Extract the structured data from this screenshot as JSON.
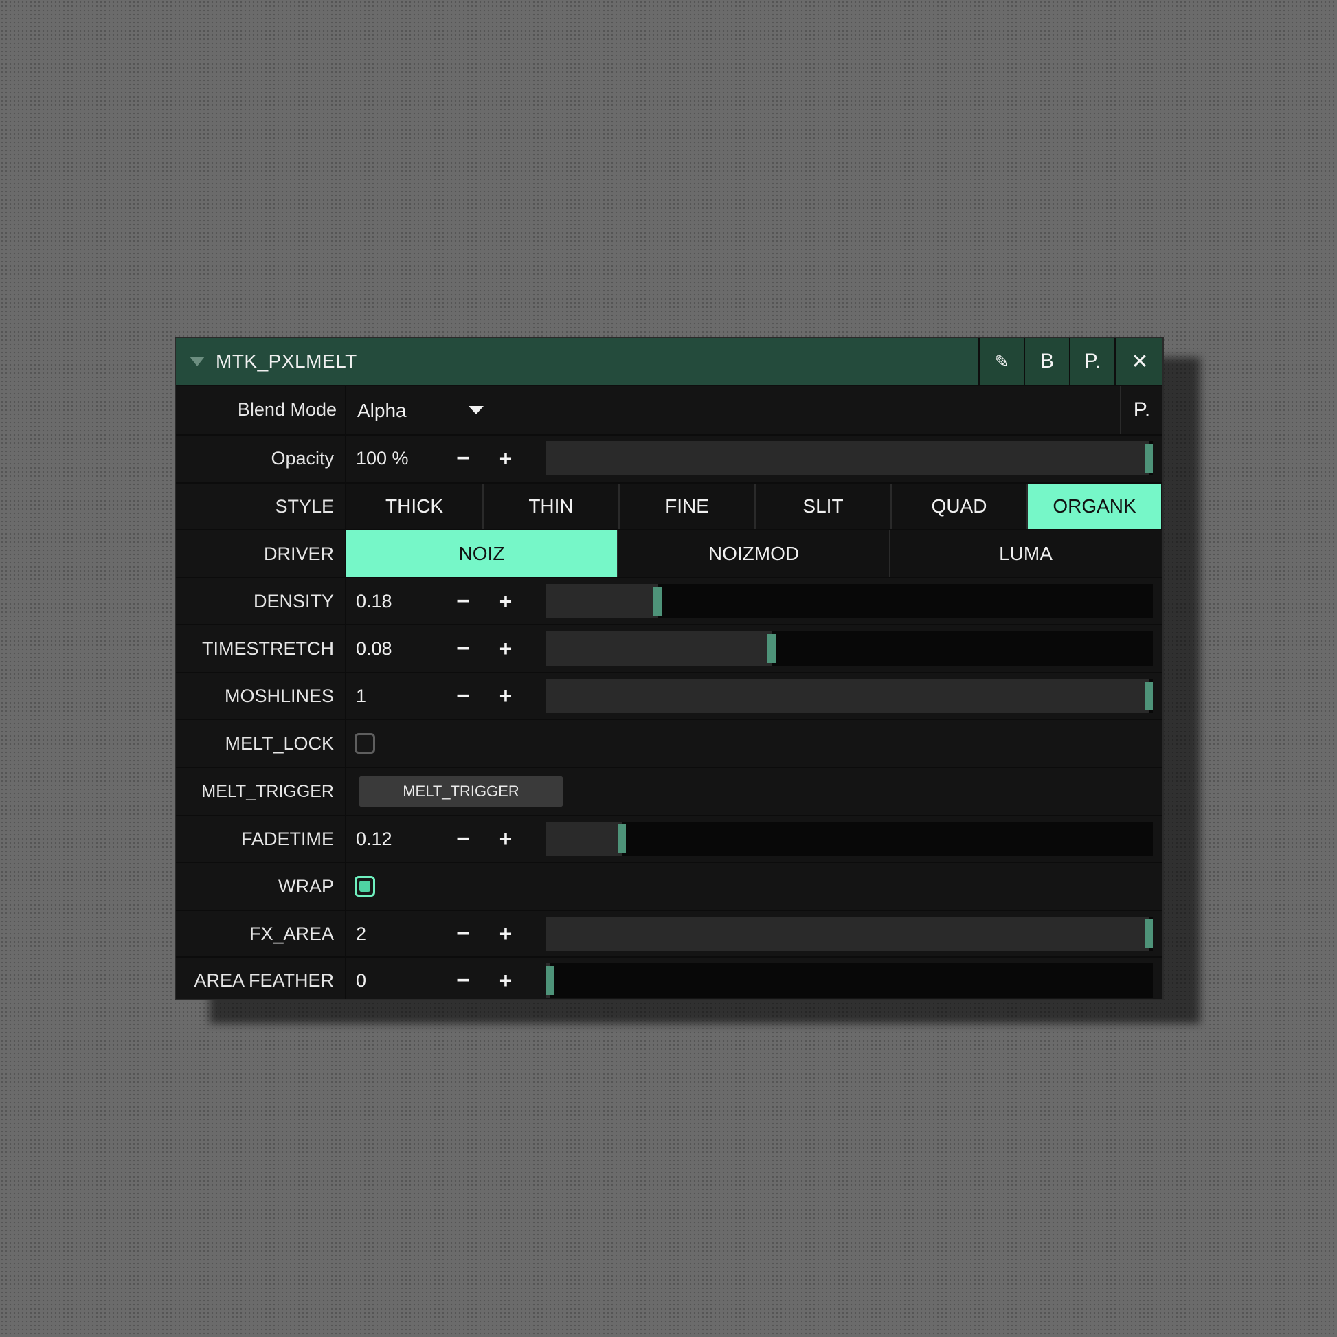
{
  "panel": {
    "title": "MTK_PXLMELT",
    "buttons": {
      "edit": "✎",
      "bypass": "B",
      "preset": "P.",
      "close": "✕"
    }
  },
  "blend": {
    "label": "Blend Mode",
    "value": "Alpha",
    "preset_button": "P."
  },
  "opacity": {
    "label": "Opacity",
    "value": "100 %",
    "minus": "−",
    "plus": "+",
    "level": 1.0
  },
  "style": {
    "label": "STYLE",
    "options": [
      "THICK",
      "THIN",
      "FINE",
      "SLIT",
      "QUAD",
      "ORGANK"
    ],
    "selected": "ORGANK"
  },
  "driver": {
    "label": "DRIVER",
    "options": [
      "NOIZ",
      "NOIZMOD",
      "LUMA"
    ],
    "selected": "NOIZ"
  },
  "params": [
    {
      "label": "DENSITY",
      "value": "0.18",
      "minus": "−",
      "plus": "+",
      "level": 0.18
    },
    {
      "label": "TIMESTRETCH",
      "value": "0.08",
      "minus": "−",
      "plus": "+",
      "level": 0.37
    },
    {
      "label": "MOSHLINES",
      "value": "1",
      "minus": "−",
      "plus": "+",
      "level": 1.0
    }
  ],
  "melt_lock": {
    "label": "MELT_LOCK",
    "checked": false
  },
  "melt_trigger": {
    "label": "MELT_TRIGGER",
    "button": "MELT_TRIGGER"
  },
  "fadetime": {
    "label": "FADETIME",
    "value": "0.12",
    "minus": "−",
    "plus": "+",
    "level": 0.12
  },
  "wrap": {
    "label": "WRAP",
    "checked": true
  },
  "fx_area": {
    "label": "FX_AREA",
    "value": "2",
    "minus": "−",
    "plus": "+",
    "level": 1.0
  },
  "area_feather": {
    "label": "AREA FEATHER",
    "value": "0",
    "minus": "−",
    "plus": "+",
    "level": 0.0
  },
  "colors": {
    "accent": "#76f7c8",
    "titlebar": "#244b3c",
    "handle": "#4e9379"
  }
}
